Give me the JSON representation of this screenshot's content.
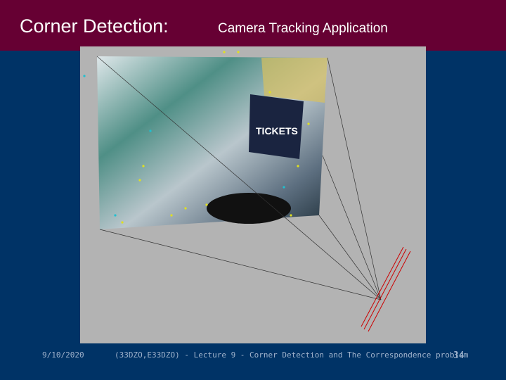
{
  "slide": {
    "title": "Corner Detection:",
    "subtitle": "Camera Tracking Application",
    "figure_label": "TICKETS",
    "footer": {
      "date": "9/10/2020",
      "course": "(33DZO,E33DZO) - Lecture 9 - Corner Detection and The Correspondence problem",
      "page": "34"
    }
  }
}
